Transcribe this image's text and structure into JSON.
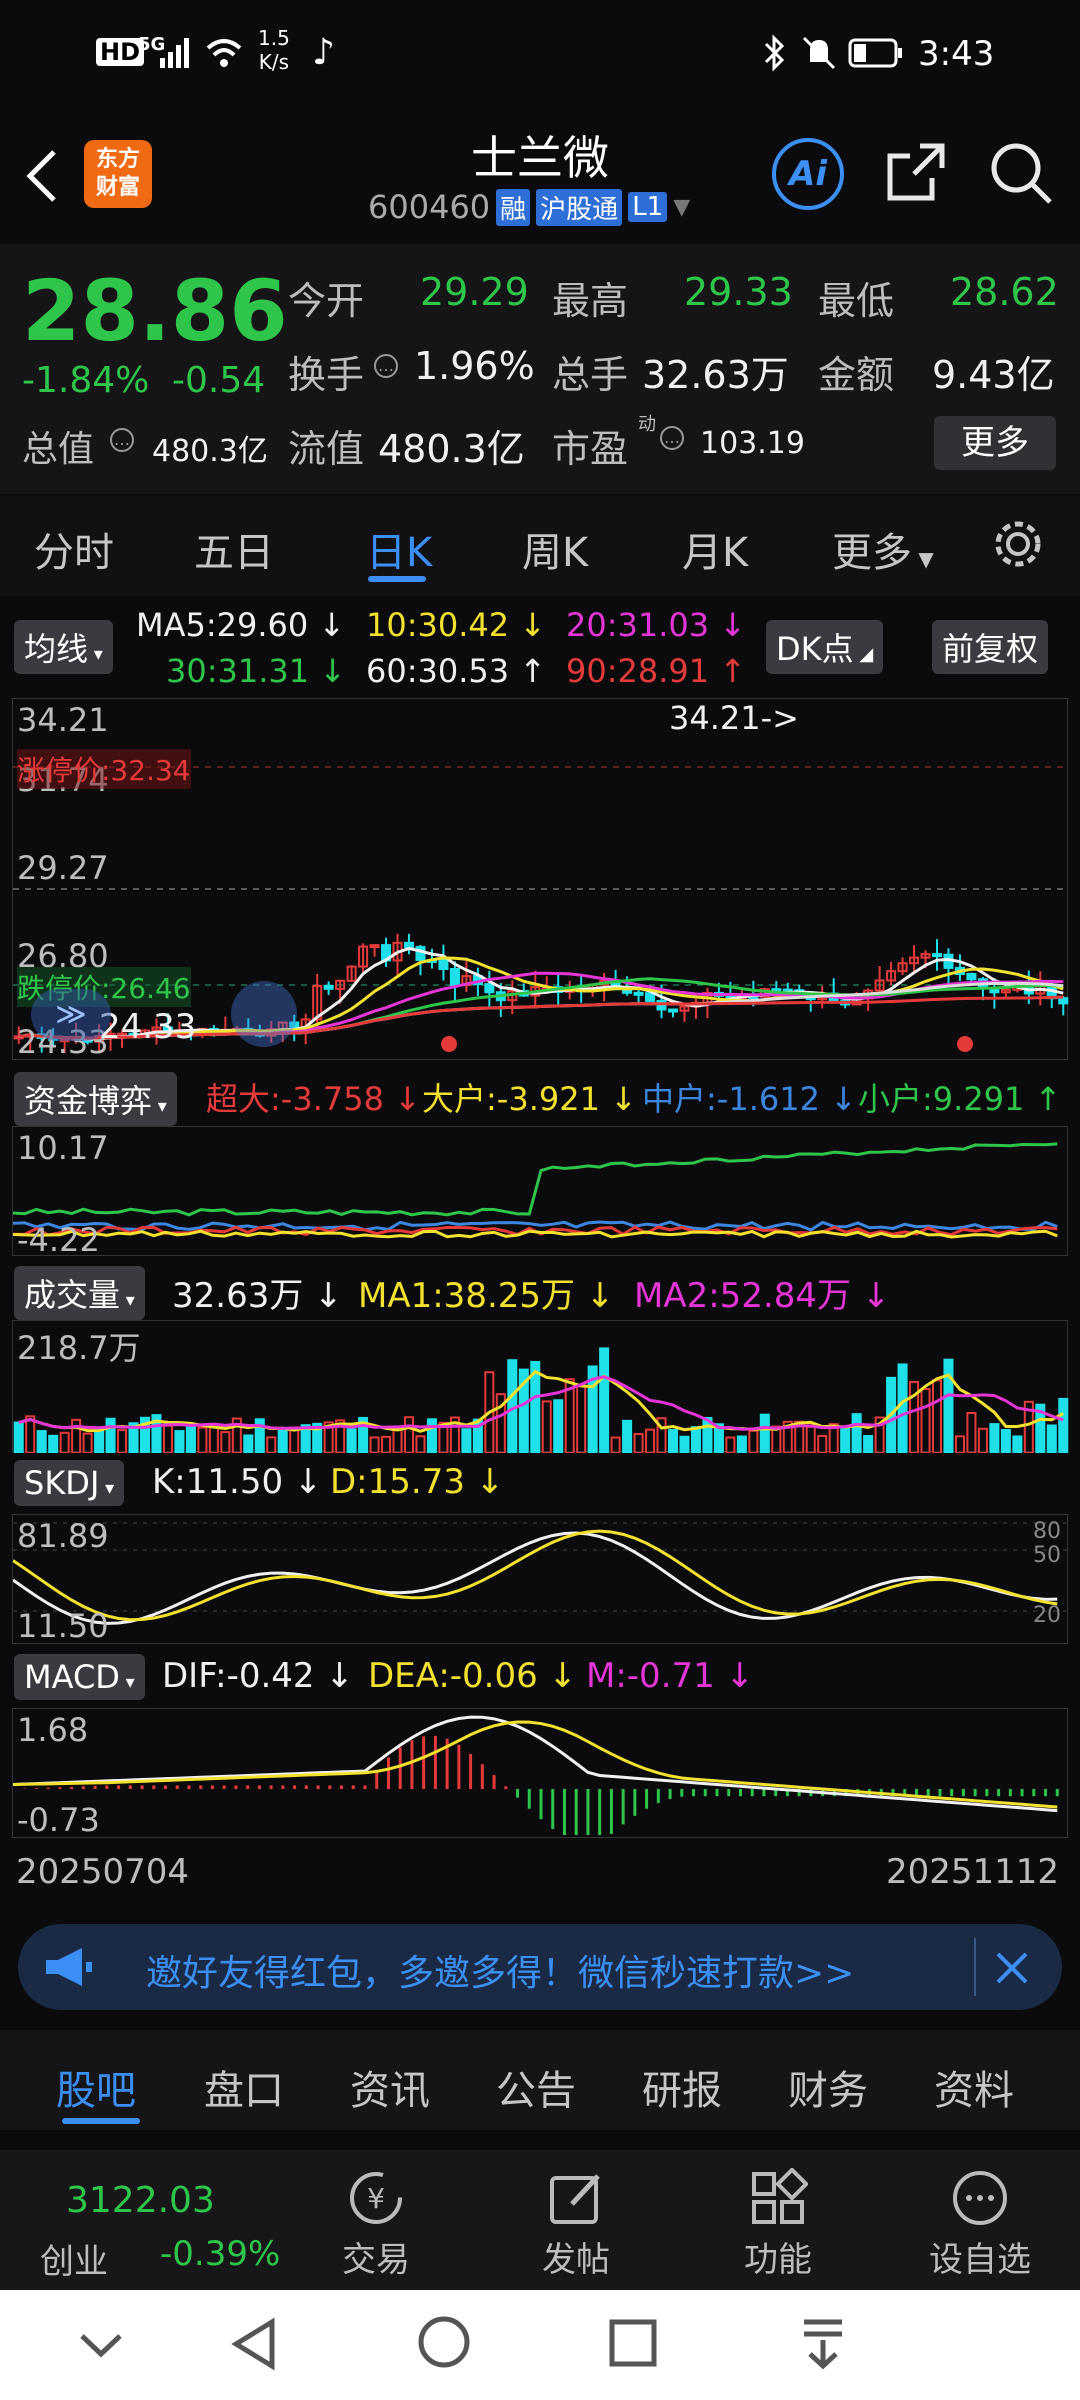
{
  "status": {
    "time": "3:43",
    "net_speed": "1.5",
    "net_unit": "K/s",
    "hd": "HD",
    "signal": "5G"
  },
  "header": {
    "title": "士兰微",
    "code": "600460",
    "badge_rong": "融",
    "badge_hgt": "沪股通",
    "badge_l1": "L1",
    "logo_line1": "东方",
    "logo_line2": "财富",
    "ai_label": "Ai"
  },
  "quote": {
    "price": "28.86",
    "change_pct": "-1.84%",
    "change": "-0.54",
    "open_label": "今开",
    "open": "29.29",
    "high_label": "最高",
    "high": "29.33",
    "low_label": "最低",
    "low": "28.62",
    "turnover_label": "换手",
    "turnover": "1.96%",
    "volume_label": "总手",
    "volume": "32.63万",
    "amount_label": "金额",
    "amount": "9.43亿",
    "total_cap_label": "总值",
    "total_cap": "480.3亿",
    "float_cap_label": "流值",
    "float_cap": "480.3亿",
    "pe_label": "市盈",
    "pe_sup": "动",
    "pe": "103.19",
    "more": "更多"
  },
  "tabs": [
    "分时",
    "五日",
    "日K",
    "周K",
    "月K",
    "更多"
  ],
  "ma": {
    "btn": "均线",
    "ma5": "MA5:29.60 ↓",
    "ma10": "10:30.42 ↓",
    "ma20": "20:31.03 ↓",
    "ma30": "30:31.31 ↓",
    "ma60": "60:30.53 ↑",
    "ma90": "90:28.91 ↑",
    "dk": "DK点",
    "fq": "前复权"
  },
  "kline": {
    "y_top": "34.21",
    "y2": "31.74",
    "y3": "29.27",
    "y4": "26.80",
    "y_bottom": "24.33",
    "limit_up": "涨停价:32.34",
    "limit_down": "跌停价:26.46",
    "max_marker": "34.21->",
    "min_marker": "24.33",
    "dates_start": "20250704",
    "dates_end": "20251112"
  },
  "fund": {
    "btn": "资金博弈",
    "super": "超大:-3.758 ↓",
    "big": "大户:-3.921 ↓",
    "mid": "中户:-1.612 ↓",
    "small": "小户:9.291 ↑",
    "y_top": "10.17",
    "y_bottom": "-4.22"
  },
  "vol": {
    "btn": "成交量",
    "cur": "32.63万 ↓",
    "ma1": "MA1:38.25万 ↓",
    "ma2": "MA2:52.84万 ↓",
    "y_top": "218.7万"
  },
  "skdj": {
    "btn": "SKDJ",
    "k": "K:11.50 ↓",
    "d": "D:15.73 ↓",
    "y_top": "81.89",
    "y_bottom": "11.50",
    "r80": "80",
    "r50": "50",
    "r20": "20"
  },
  "macd": {
    "btn": "MACD",
    "dif": "DIF:-0.42 ↓",
    "dea": "DEA:-0.06 ↓",
    "m": "M:-0.71 ↓",
    "y_top": "1.68",
    "y_bottom": "-0.73"
  },
  "banner": {
    "text": "邀好友得红包，多邀多得！微信秒速打款>>"
  },
  "bottom_tabs": [
    "股吧",
    "盘口",
    "资讯",
    "公告",
    "研报",
    "财务",
    "资料"
  ],
  "dock": {
    "index_value": "3122.03",
    "index_name": "创业",
    "index_change": "-0.39%",
    "trade": "交易",
    "post": "发帖",
    "func": "功能",
    "watch": "设自选"
  }
}
